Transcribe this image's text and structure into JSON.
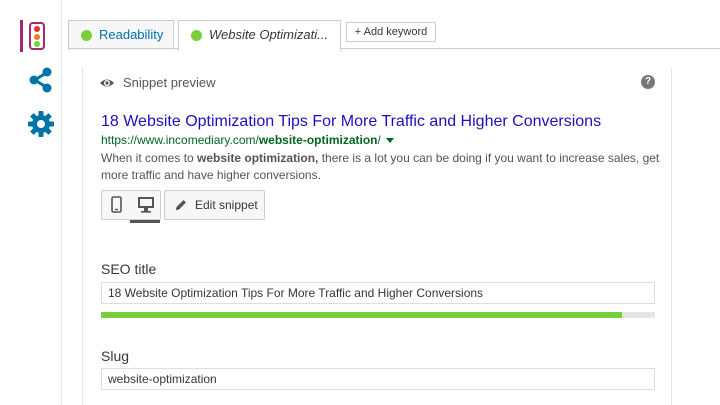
{
  "colors": {
    "accent": "#a4286a",
    "good": "#7ad03a",
    "link": "#0073aa",
    "serp_title": "#1e0fbe",
    "serp_url": "#006621",
    "rail_icon": "#0073aa",
    "traffic_red": "#dc3232",
    "traffic_orange": "#ee7c1b",
    "traffic_green": "#7ad03a"
  },
  "sidebar": {
    "items": [
      {
        "icon": "traffic-light-icon"
      },
      {
        "icon": "share-icon"
      },
      {
        "icon": "gear-icon"
      }
    ]
  },
  "tabs": [
    {
      "label": "Readability",
      "status_icon": "green-dot-icon"
    },
    {
      "label": "Website Optimizati...",
      "status_icon": "green-dot-icon"
    }
  ],
  "add_keyword_label": "+ Add keyword",
  "snippet": {
    "header": "Snippet preview",
    "help_label": "?",
    "title": "18 Website Optimization Tips For More Traffic and Higher Conversions",
    "url_base": "https://www.incomediary.com/",
    "url_slug": "website-optimization",
    "url_end": "/",
    "desc_pre": "When it comes to ",
    "desc_bold": "website optimization,",
    "desc_post": " there is a lot you can be doing if you want to increase sales, get more traffic and have higher conversions.",
    "edit_label": "Edit snippet"
  },
  "fields": {
    "seo_title_label": "SEO title",
    "seo_title_value": "18 Website Optimization Tips For More Traffic and Higher Conversions",
    "seo_title_progress": 0.94,
    "slug_label": "Slug",
    "slug_value": "website-optimization"
  }
}
